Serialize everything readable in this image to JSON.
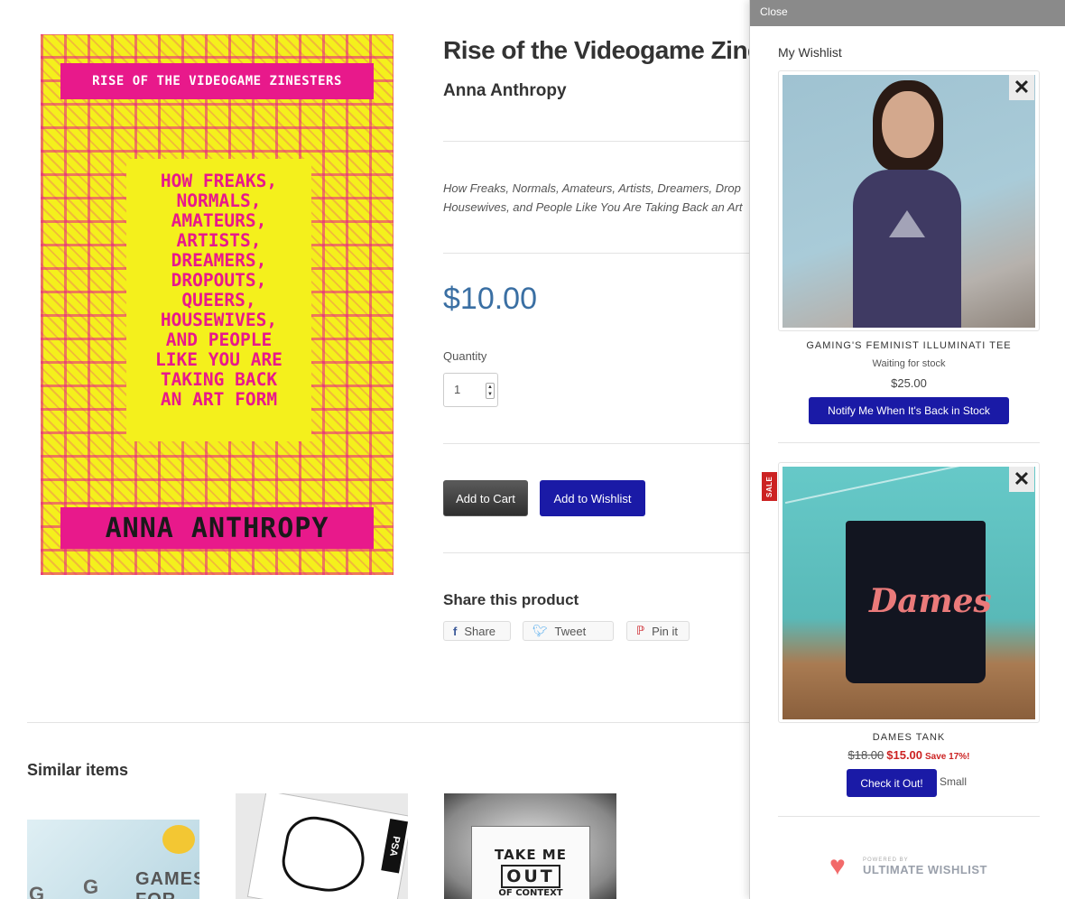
{
  "product": {
    "title": "Rise of the Videogame Zinest",
    "author": "Anna Anthropy",
    "description": "How Freaks, Normals, Amateurs, Artists, Dreamers, Drop\nHousewives, and People Like You Are Taking Back an Art",
    "price": "$10.00",
    "quantity_label": "Quantity",
    "quantity_value": "1",
    "add_to_cart": "Add to Cart",
    "add_to_wishlist": "Add to Wishlist",
    "cover": {
      "top_text": "RISE OF THE VIDEOGAME ZINESTERS",
      "middle_text": "HOW FREAKS,\nNORMALS,\nAMATEURS,\nARTISTS,\nDREAMERS,\nDROPOUTS,\nQUEERS,\nHOUSEWIVES,\nAND PEOPLE\nLIKE YOU ARE\nTAKING BACK\nAN ART FORM",
      "bottom_text": "ANNA ANTHROPY",
      "colors": {
        "magenta": "#e8198b",
        "yellow": "#f4f01c"
      }
    }
  },
  "share": {
    "heading": "Share this product",
    "buttons": [
      {
        "label": "Share",
        "icon": "facebook-icon"
      },
      {
        "label": "Tweet",
        "icon": "twitter-icon"
      },
      {
        "label": "Pin it",
        "icon": "pinterest-icon"
      }
    ]
  },
  "similar": {
    "heading": "Similar items",
    "items": [
      {
        "thumb_text": "GAMES FOR"
      },
      {
        "thumb_text": "PSA"
      },
      {
        "thumb_text_1": "TAKE ME",
        "thumb_text_2": "OUT",
        "thumb_text_3": "OF CONTEXT"
      }
    ]
  },
  "wishlist": {
    "close_label": "Close",
    "title": "My Wishlist",
    "items": [
      {
        "name": "GAMING'S FEMINIST ILLUMINATI TEE",
        "status": "Waiting for stock",
        "price": "$25.00",
        "action": "Notify Me When It's Back in Stock"
      },
      {
        "sale_badge": "SALE",
        "name": "DAMES TANK",
        "photo_text": "Dames",
        "old_price": "$18.00",
        "new_price": "$15.00",
        "save_text": "Save 17%!",
        "action": "Check it Out!",
        "variant": "Small"
      }
    ],
    "powered_by_small": "POWERED BY",
    "powered_by_brand": "ULTIMATE WISHLIST"
  },
  "colors": {
    "accent_blue": "#1a1aa6",
    "price_blue": "#3a6fa3",
    "sale_red": "#cc2222"
  }
}
